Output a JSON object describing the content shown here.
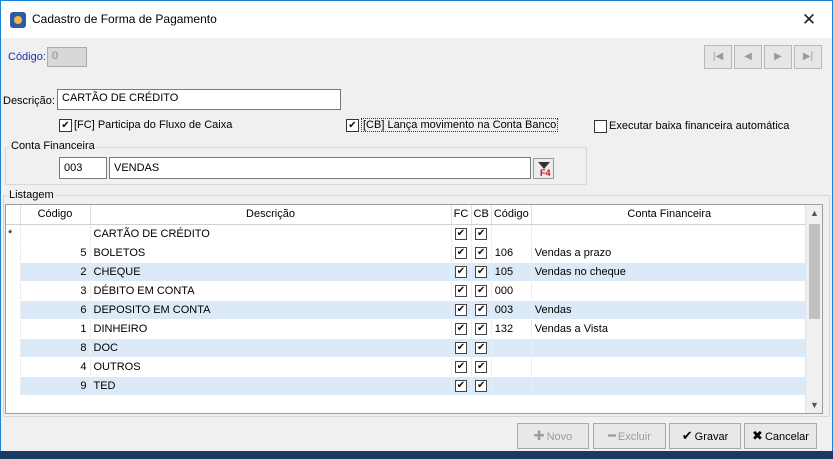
{
  "window": {
    "title": "Cadastro de Forma de Pagamento",
    "close": "✕"
  },
  "codigo": {
    "label": "Código:",
    "value": "0"
  },
  "nav": {
    "first": "|◀",
    "prev": "◀",
    "next": "▶",
    "last": "▶|"
  },
  "descricao": {
    "label": "Descrição:",
    "value": "CARTÃO DE CRÉDITO"
  },
  "checks": {
    "fc_label": "[FC] Participa do Fluxo de Caixa",
    "fc_checked": true,
    "cb_label": "[CB] Lança movimento na Conta Banco",
    "cb_checked": true,
    "baixa_label": "Executar baixa financeira automática",
    "baixa_checked": false
  },
  "conta_financeira": {
    "group_title": "Conta Financeira",
    "code": "003",
    "name": "VENDAS",
    "lookup_key": "F4"
  },
  "listagem": {
    "group_title": "Listagem",
    "columns": [
      "Código",
      "Descrição",
      "FC",
      "CB",
      "Código",
      "Conta Financeira"
    ],
    "rows": [
      {
        "indicator": "*",
        "codigo": "",
        "descricao": "CARTÃO DE CRÉDITO",
        "fc": true,
        "cb": true,
        "conta_codigo": "",
        "conta_nome": ""
      },
      {
        "indicator": "",
        "codigo": "5",
        "descricao": "BOLETOS",
        "fc": true,
        "cb": true,
        "conta_codigo": "106",
        "conta_nome": "Vendas a prazo"
      },
      {
        "indicator": "",
        "codigo": "2",
        "descricao": "CHEQUE",
        "fc": true,
        "cb": true,
        "conta_codigo": "105",
        "conta_nome": "Vendas no cheque"
      },
      {
        "indicator": "",
        "codigo": "3",
        "descricao": "DÉBITO EM CONTA",
        "fc": true,
        "cb": true,
        "conta_codigo": "000",
        "conta_nome": ""
      },
      {
        "indicator": "",
        "codigo": "6",
        "descricao": "DEPOSITO EM CONTA",
        "fc": true,
        "cb": true,
        "conta_codigo": "003",
        "conta_nome": "Vendas"
      },
      {
        "indicator": "",
        "codigo": "1",
        "descricao": "DINHEIRO",
        "fc": true,
        "cb": true,
        "conta_codigo": "132",
        "conta_nome": "Vendas a Vista"
      },
      {
        "indicator": "",
        "codigo": "8",
        "descricao": "DOC",
        "fc": true,
        "cb": true,
        "conta_codigo": "",
        "conta_nome": ""
      },
      {
        "indicator": "",
        "codigo": "4",
        "descricao": "OUTROS",
        "fc": true,
        "cb": true,
        "conta_codigo": "",
        "conta_nome": ""
      },
      {
        "indicator": "",
        "codigo": "9",
        "descricao": "TED",
        "fc": true,
        "cb": true,
        "conta_codigo": "",
        "conta_nome": ""
      }
    ]
  },
  "buttons": {
    "novo": "Novo",
    "excluir": "Excluir",
    "gravar": "Gravar",
    "cancelar": "Cancelar"
  },
  "colors": {
    "accent": "#1883d7",
    "row_alt": "#dce9f7",
    "label_blue": "#1d31a8"
  }
}
